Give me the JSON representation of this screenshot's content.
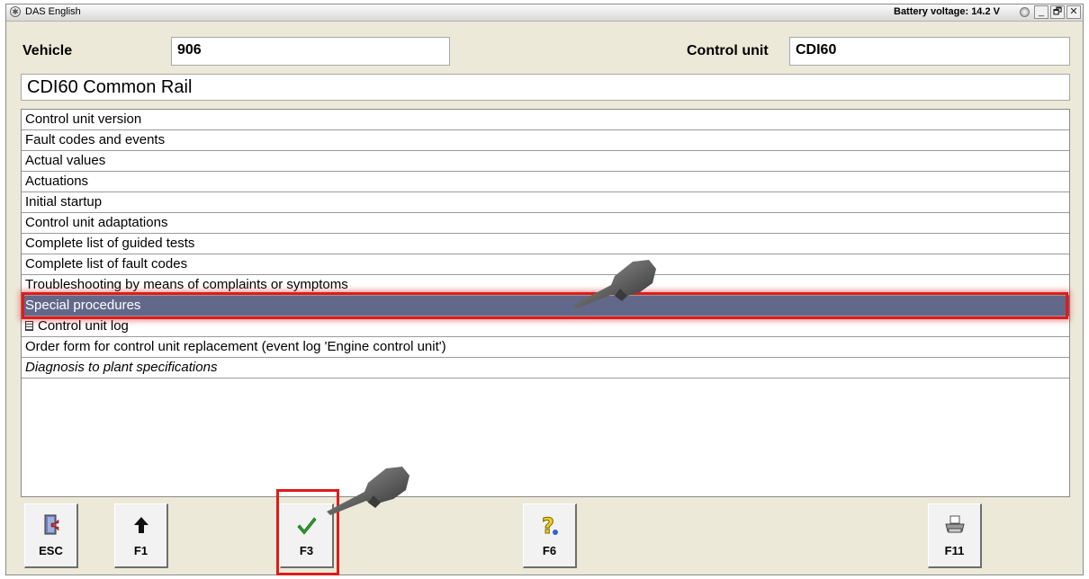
{
  "window": {
    "title": "DAS English",
    "battery_voltage": "Battery voltage: 14.2 V",
    "controls": {
      "minimize": "_",
      "maximize": "🗗",
      "close": "✕"
    }
  },
  "header": {
    "vehicle_label": "Vehicle",
    "vehicle_value": "906",
    "control_unit_label": "Control unit",
    "control_unit_value": "CDI60"
  },
  "page_title": "CDI60 Common Rail",
  "menu": {
    "items": [
      {
        "label": "Control unit version"
      },
      {
        "label": "Fault codes and events"
      },
      {
        "label": "Actual values"
      },
      {
        "label": "Actuations"
      },
      {
        "label": "Initial startup"
      },
      {
        "label": "Control unit adaptations"
      },
      {
        "label": "Complete list of guided tests"
      },
      {
        "label": "Complete list of fault codes"
      },
      {
        "label": "Troubleshooting by means of complaints or symptoms"
      },
      {
        "label": "Special procedures",
        "selected": true
      },
      {
        "label": "Control unit log",
        "icon": "document-icon"
      },
      {
        "label": "Order form for control unit replacement (event log 'Engine control unit')"
      },
      {
        "label": "Diagnosis to plant specifications",
        "italic": true
      }
    ]
  },
  "toolbar": {
    "esc_label": "ESC",
    "f1_label": "F1",
    "f3_label": "F3",
    "f6_label": "F6",
    "f11_label": "F11",
    "esc_icon": "exit-door-icon",
    "f1_icon": "up-arrow-icon",
    "f3_icon": "checkmark-icon",
    "f6_icon": "help-question-icon",
    "f11_icon": "printer-icon"
  },
  "colors": {
    "selection_bg": "#62688a",
    "highlight": "#e01b1b",
    "check_green": "#2e9e2e",
    "help_yellow": "#f2d21b"
  }
}
